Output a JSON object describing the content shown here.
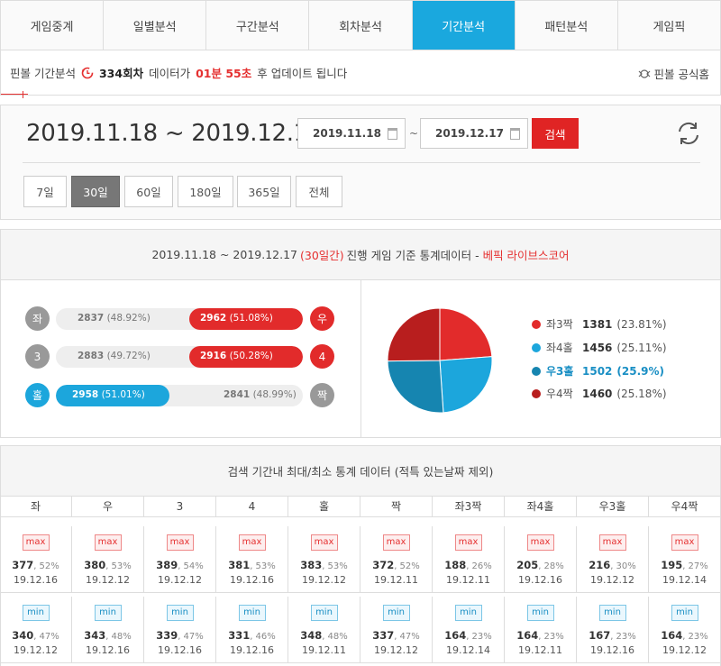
{
  "tabs": [
    "게임중계",
    "일별분석",
    "구간분석",
    "회차분석",
    "기간분석",
    "패턴분석",
    "게임픽"
  ],
  "active_tab": 4,
  "info": {
    "prefix": "핀볼 기간분석",
    "round": "334회차",
    "mid": "데이터가",
    "time": "01분 55초",
    "suffix": "후 업데이트 됩니다",
    "official": "핀볼 공식홈"
  },
  "search": {
    "range_title": "2019.11.18 ~ 2019.12.17",
    "start": "2019.11.18",
    "tilde": "~",
    "end": "2019.12.17",
    "button": "검색"
  },
  "periods": [
    "7일",
    "30일",
    "60일",
    "180일",
    "365일",
    "전체"
  ],
  "active_period": 1,
  "stats": {
    "head_range": "2019.11.18 ~ 2019.12.17",
    "head_days": "(30일간)",
    "head_text": "진행 게임 기준 통계데이터 -",
    "head_brand": "베픽 라이브스코어",
    "rows": [
      {
        "left_label": "좌",
        "left_text": "2837",
        "left_pct": "(48.92%)",
        "right_text": "2962",
        "right_pct": "(51.08%)",
        "right_label": "우",
        "winner": "right",
        "fill": 0.51
      },
      {
        "left_label": "3",
        "left_text": "2883",
        "left_pct": "(49.72%)",
        "right_text": "2916",
        "right_pct": "(50.28%)",
        "right_label": "4",
        "winner": "right",
        "fill": 0.5
      },
      {
        "left_label": "홀",
        "left_text": "2958",
        "left_pct": "(51.01%)",
        "right_text": "2841",
        "right_pct": "(48.99%)",
        "right_label": "짝",
        "winner": "left",
        "fill": 0.51
      }
    ],
    "pie": [
      {
        "label": "좌3짝",
        "count": "1381",
        "pct": "(23.81%)",
        "value": 23.81,
        "color": "#e22b2b"
      },
      {
        "label": "좌4홀",
        "count": "1456",
        "pct": "(25.11%)",
        "value": 25.11,
        "color": "#1ca6dc"
      },
      {
        "label": "우3홀",
        "count": "1502",
        "pct": "(25.9%)",
        "value": 25.9,
        "color": "#1685b0"
      },
      {
        "label": "우4짝",
        "count": "1460",
        "pct": "(25.18%)",
        "value": 25.18,
        "color": "#b81e1e"
      }
    ]
  },
  "maxmin": {
    "title": "검색 기간내 최대/최소 통계 데이터 (적특 있는날짜 제외)",
    "max_tag": "max",
    "min_tag": "min",
    "columns": [
      "좌",
      "우",
      "3",
      "4",
      "홀",
      "짝",
      "좌3짝",
      "좌4홀",
      "우3홀",
      "우4짝"
    ],
    "max": [
      {
        "v": "377",
        "p": ", 52%",
        "d": "19.12.16"
      },
      {
        "v": "380",
        "p": ", 53%",
        "d": "19.12.12"
      },
      {
        "v": "389",
        "p": ", 54%",
        "d": "19.12.12"
      },
      {
        "v": "381",
        "p": ", 53%",
        "d": "19.12.16"
      },
      {
        "v": "383",
        "p": ", 53%",
        "d": "19.12.12"
      },
      {
        "v": "372",
        "p": ", 52%",
        "d": "19.12.11"
      },
      {
        "v": "188",
        "p": ", 26%",
        "d": "19.12.11"
      },
      {
        "v": "205",
        "p": ", 28%",
        "d": "19.12.16"
      },
      {
        "v": "216",
        "p": ", 30%",
        "d": "19.12.12"
      },
      {
        "v": "195",
        "p": ", 27%",
        "d": "19.12.14"
      }
    ],
    "min": [
      {
        "v": "340",
        "p": ", 47%",
        "d": "19.12.12"
      },
      {
        "v": "343",
        "p": ", 48%",
        "d": "19.12.16"
      },
      {
        "v": "339",
        "p": ", 47%",
        "d": "19.12.16"
      },
      {
        "v": "331",
        "p": ", 46%",
        "d": "19.12.16"
      },
      {
        "v": "348",
        "p": ", 48%",
        "d": "19.12.11"
      },
      {
        "v": "337",
        "p": ", 47%",
        "d": "19.12.12"
      },
      {
        "v": "164",
        "p": ", 23%",
        "d": "19.12.14"
      },
      {
        "v": "164",
        "p": ", 23%",
        "d": "19.12.11"
      },
      {
        "v": "167",
        "p": ", 23%",
        "d": "19.12.16"
      },
      {
        "v": "164",
        "p": ", 23%",
        "d": "19.12.12"
      }
    ]
  }
}
